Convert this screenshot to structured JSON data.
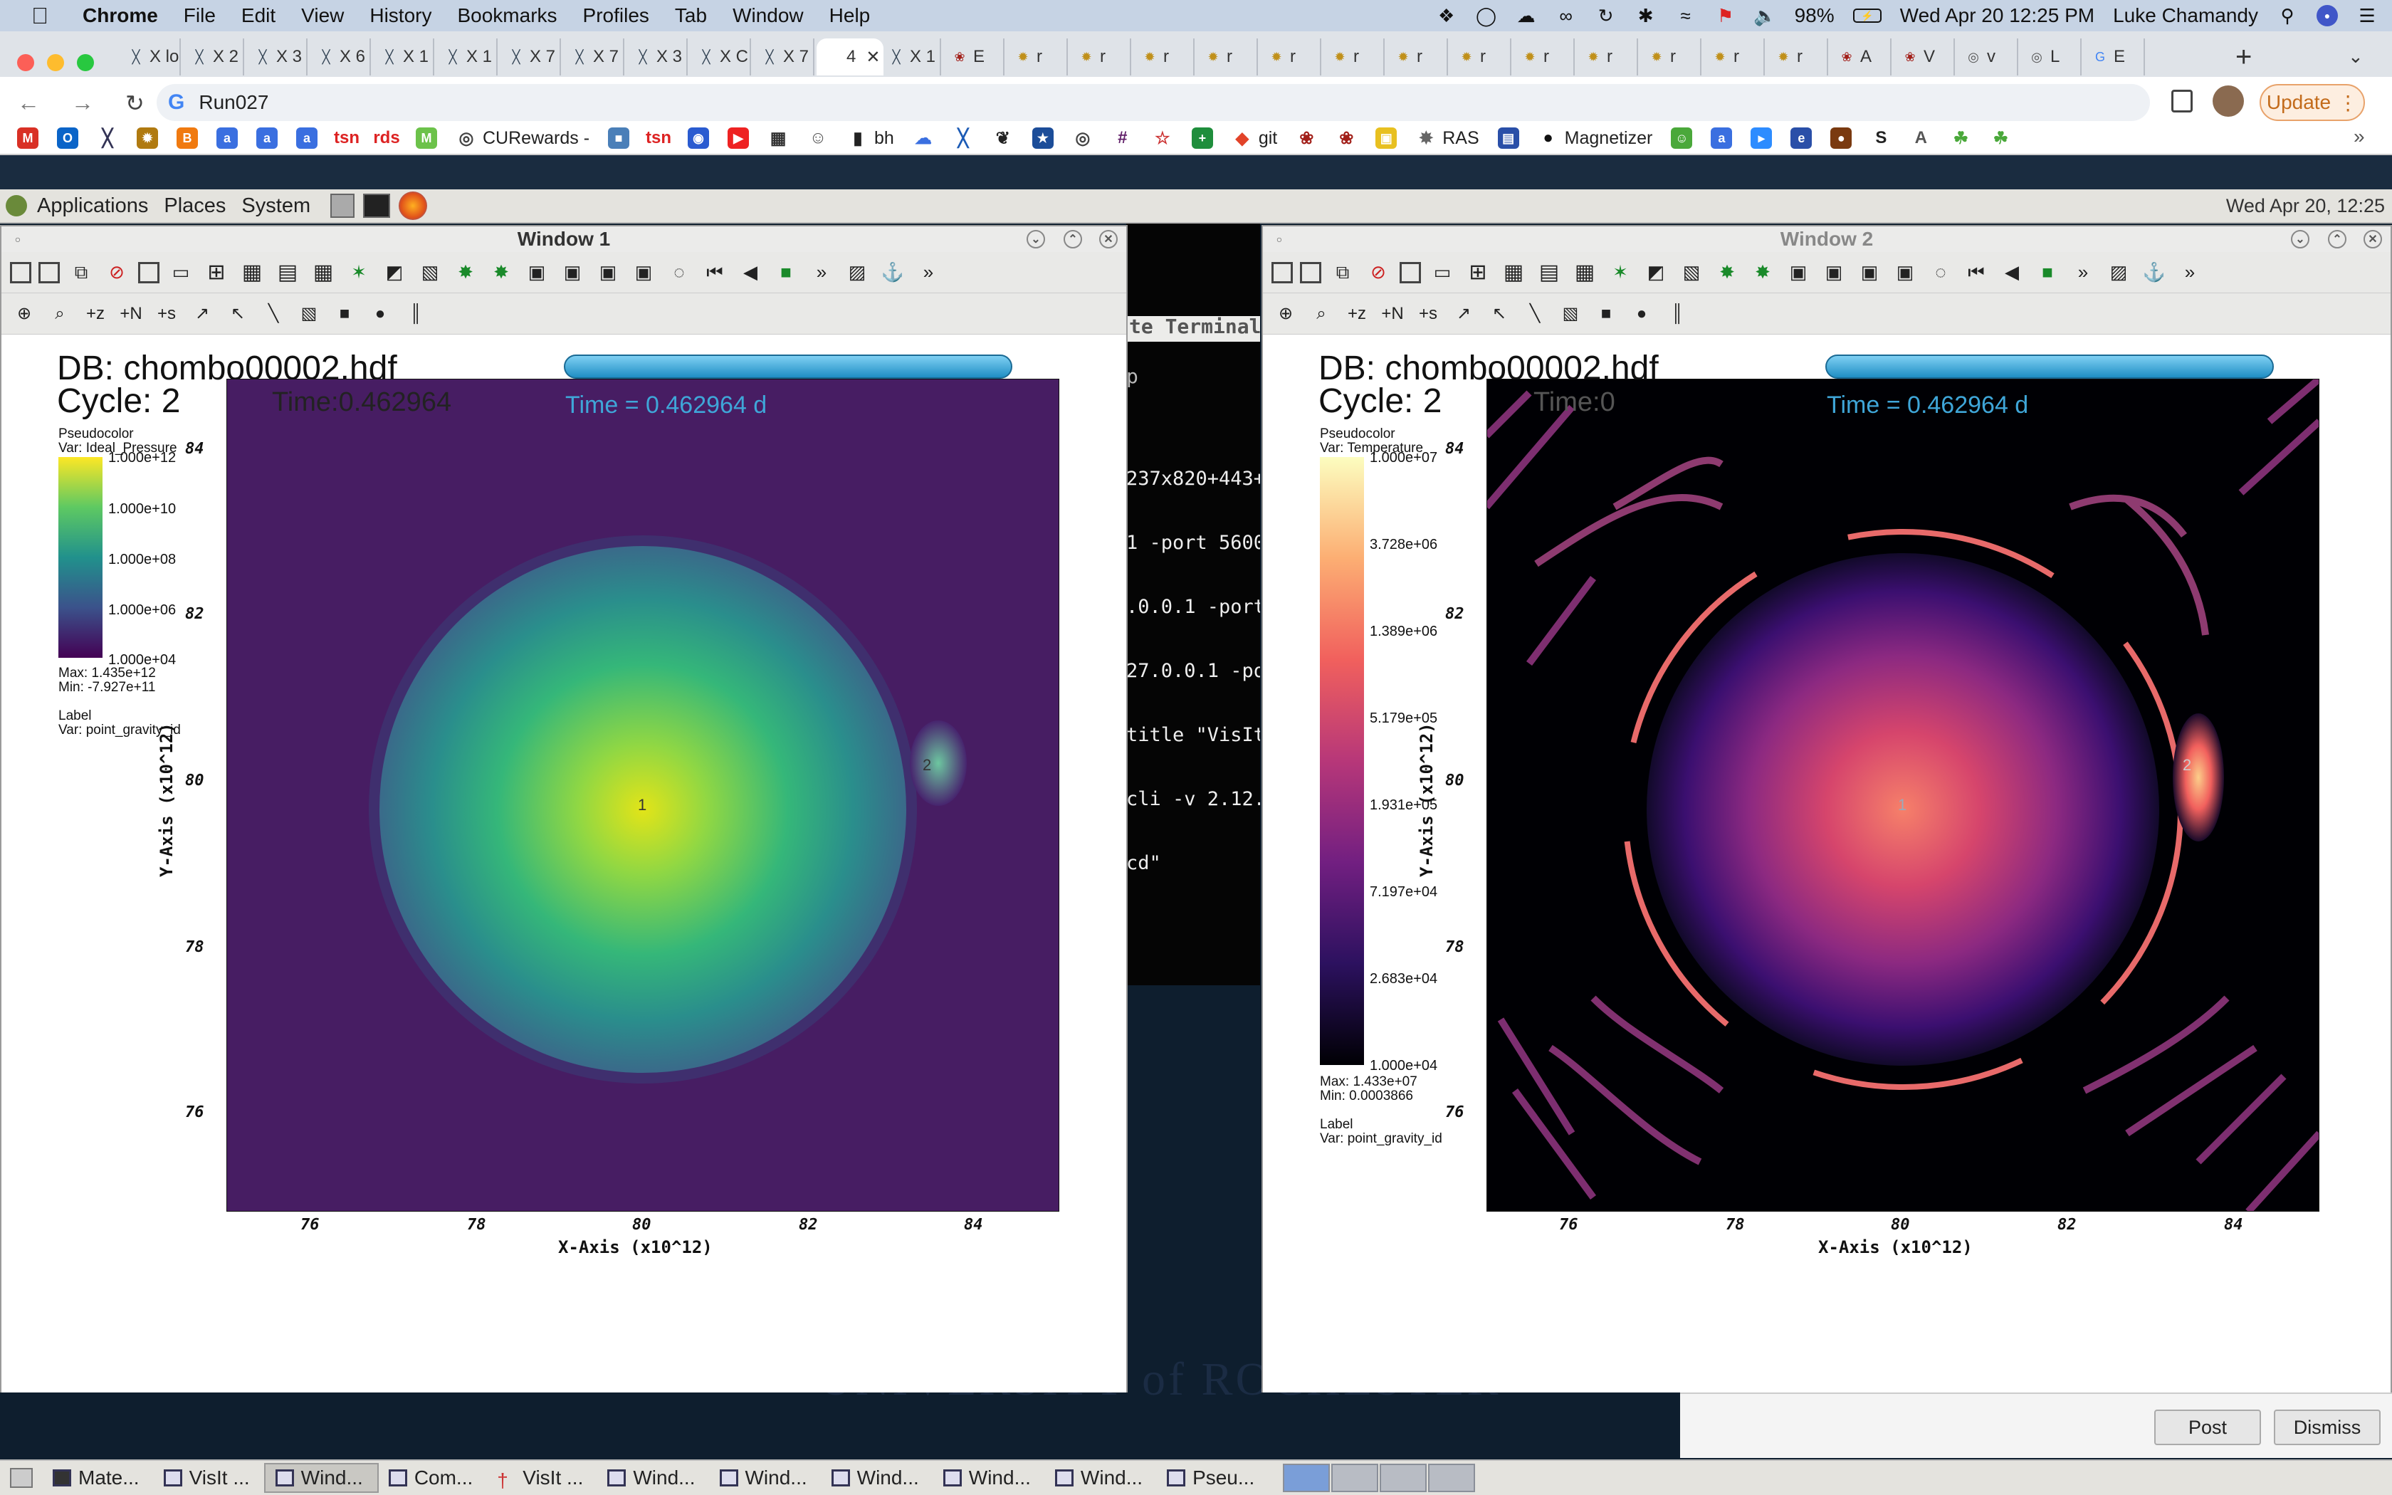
{
  "menubar": {
    "app": "Chrome",
    "items": [
      "File",
      "Edit",
      "View",
      "History",
      "Bookmarks",
      "Profiles",
      "Tab",
      "Window",
      "Help"
    ],
    "battery": "98%",
    "clock": "Wed Apr 20  12:25 PM",
    "user": "Luke Chamandy"
  },
  "browser": {
    "tabs": [
      {
        "label": "X lo",
        "icon": "x-tab-icon"
      },
      {
        "label": "X 2",
        "icon": "x-tab-icon"
      },
      {
        "label": "X 3",
        "icon": "x-tab-icon"
      },
      {
        "label": "X 6",
        "icon": "x-tab-icon"
      },
      {
        "label": "X 1",
        "icon": "x-tab-icon"
      },
      {
        "label": "X 1",
        "icon": "x-tab-icon"
      },
      {
        "label": "X 7",
        "icon": "x-tab-icon"
      },
      {
        "label": "X 7",
        "icon": "x-tab-icon"
      },
      {
        "label": "X 3",
        "icon": "x-tab-icon"
      },
      {
        "label": "X C",
        "icon": "x-tab-icon"
      },
      {
        "label": "X 7",
        "icon": "x-tab-icon"
      },
      {
        "label": "4",
        "icon": "active-tab",
        "active": true
      },
      {
        "label": "X 1",
        "icon": "x-tab-icon"
      },
      {
        "label": "E",
        "icon": "paw-icon"
      },
      {
        "label": "r",
        "icon": "star-burst-icon"
      },
      {
        "label": "r",
        "icon": "star-burst-icon"
      },
      {
        "label": "r",
        "icon": "star-burst-icon"
      },
      {
        "label": "r",
        "icon": "star-burst-icon"
      },
      {
        "label": "r",
        "icon": "star-burst-icon"
      },
      {
        "label": "r",
        "icon": "star-burst-icon"
      },
      {
        "label": "r",
        "icon": "star-burst-icon"
      },
      {
        "label": "r",
        "icon": "star-burst-icon"
      },
      {
        "label": "r",
        "icon": "star-burst-icon"
      },
      {
        "label": "r",
        "icon": "star-burst-icon"
      },
      {
        "label": "r",
        "icon": "star-burst-icon"
      },
      {
        "label": "r",
        "icon": "star-burst-icon"
      },
      {
        "label": "r",
        "icon": "star-burst-icon"
      },
      {
        "label": "A",
        "icon": "paw-icon"
      },
      {
        "label": "V",
        "icon": "paw-icon"
      },
      {
        "label": "v",
        "icon": "globe-icon"
      },
      {
        "label": "L",
        "icon": "globe-icon"
      },
      {
        "label": "E",
        "icon": "google-icon"
      }
    ],
    "address": "Run027",
    "update_label": "Update",
    "bookmarks": [
      {
        "label": "",
        "icon": "gmail-icon",
        "color": "#d93025"
      },
      {
        "label": "",
        "icon": "outlook-icon",
        "color": "#0a64c8"
      },
      {
        "label": "",
        "icon": "x-bookmark-icon",
        "color": "#335"
      },
      {
        "label": "",
        "icon": "sun-icon",
        "color": "#b07a10"
      },
      {
        "label": "",
        "icon": "blogger-icon",
        "color": "#f07a10"
      },
      {
        "label": "",
        "icon": "a-icon",
        "color": "#3a6fe0"
      },
      {
        "label": "",
        "icon": "a-icon",
        "color": "#3a6fe0"
      },
      {
        "label": "",
        "icon": "a-icon",
        "color": "#3a6fe0"
      },
      {
        "label": "",
        "icon": "tsn-icon",
        "color": "#d22"
      },
      {
        "label": "",
        "icon": "rds-icon",
        "color": "#d22"
      },
      {
        "label": "",
        "icon": "m-icon",
        "color": "#6cc24a"
      },
      {
        "label": "CURewards -",
        "icon": "globe-icon",
        "color": "#444"
      },
      {
        "label": "",
        "icon": "square-icon",
        "color": "#4a7fb8"
      },
      {
        "label": "",
        "icon": "tsn-icon",
        "color": "#d22"
      },
      {
        "label": "",
        "icon": "circle-icon",
        "color": "#2a5bd0"
      },
      {
        "label": "",
        "icon": "youtube-icon",
        "color": "#e22"
      },
      {
        "label": "",
        "icon": "qr-icon",
        "color": "#333"
      },
      {
        "label": "",
        "icon": "face-icon",
        "color": "#555"
      },
      {
        "label": "bh",
        "icon": "book-icon",
        "color": "#222"
      },
      {
        "label": "",
        "icon": "cloud-icon",
        "color": "#3a6fe0"
      },
      {
        "label": "",
        "icon": "x-bookmark-icon",
        "color": "#1c5bb5"
      },
      {
        "label": "",
        "icon": "cat-icon",
        "color": "#222"
      },
      {
        "label": "",
        "icon": "star-icon",
        "color": "#1c4d99"
      },
      {
        "label": "",
        "icon": "globe-icon",
        "color": "#444"
      },
      {
        "label": "",
        "icon": "slack-icon",
        "color": "#611f69"
      },
      {
        "label": "",
        "icon": "star-outline-icon",
        "color": "#c33"
      },
      {
        "label": "",
        "icon": "plus-icon",
        "color": "#1f8e3c"
      },
      {
        "label": "git",
        "icon": "gitlab-icon",
        "color": "#e24329"
      },
      {
        "label": "",
        "icon": "paw-icon",
        "color": "#a2201a"
      },
      {
        "label": "",
        "icon": "paw-icon",
        "color": "#a2201a"
      },
      {
        "label": "",
        "icon": "lock-icon",
        "color": "#e8c020"
      },
      {
        "label": "RAS",
        "icon": "spinner-icon",
        "color": "#666"
      },
      {
        "label": "",
        "icon": "calendar-icon",
        "color": "#2a4fa8"
      },
      {
        "label": "Magnetizer",
        "icon": "github-icon",
        "color": "#111"
      },
      {
        "label": "",
        "icon": "smile-icon",
        "color": "#4aa83a"
      },
      {
        "label": "",
        "icon": "a-icon",
        "color": "#3a6fe0"
      },
      {
        "label": "",
        "icon": "zoom-icon",
        "color": "#2d8cff"
      },
      {
        "label": "",
        "icon": "e-icon",
        "color": "#2a4fa8"
      },
      {
        "label": "",
        "icon": "planet-icon",
        "color": "#7a3a10"
      },
      {
        "label": "",
        "icon": "s-icon",
        "color": "#222"
      },
      {
        "label": "",
        "icon": "ai-icon",
        "color": "#555"
      },
      {
        "label": "",
        "icon": "leaf-icon",
        "color": "#4aa83a"
      },
      {
        "label": "",
        "icon": "leaf-icon",
        "color": "#4aa83a"
      }
    ]
  },
  "gnome": {
    "items": [
      "Applications",
      "Places",
      "System"
    ],
    "clock": "Wed Apr 20, 12:25"
  },
  "window1": {
    "title": "Window 1",
    "db": "DB: chombo00002.hdf",
    "cycle": "Cycle: 2",
    "time_overlay": "Time:0.462964",
    "time_blue": "Time = 0.462964 d",
    "legend": {
      "kind": "Pseudocolor",
      "var": "Var: Ideal_Pressure",
      "ticks": [
        "1.000e+12",
        "1.000e+10",
        "1.000e+08",
        "1.000e+06",
        "1.000e+04"
      ],
      "max": "Max:  1.435e+12",
      "min": "Min:  -7.927e+11",
      "label_kind": "Label",
      "label_var": "Var: point_gravity_id"
    },
    "marker": "1",
    "marker2": "2"
  },
  "window2": {
    "title": "Window 2",
    "db": "DB: chombo00002.hdf",
    "cycle": "Cycle: 2",
    "time_overlay": "Time:0",
    "time_blue": "Time = 0.462964 d",
    "legend": {
      "kind": "Pseudocolor",
      "var": "Var: Temperature",
      "ticks": [
        "1.000e+07",
        "3.728e+06",
        "1.389e+06",
        "5.179e+05",
        "1.931e+05",
        "7.197e+04",
        "2.683e+04",
        "1.000e+04"
      ],
      "max": "Max:  1.433e+07",
      "min": "Min:  0.0003866",
      "label_kind": "Label",
      "label_var": "Var: point_gravity_id"
    },
    "marker": "1",
    "marker2": "2"
  },
  "axes": {
    "x_ticks": [
      "76",
      "78",
      "80",
      "82",
      "84"
    ],
    "y_ticks": [
      "84",
      "82",
      "80",
      "78",
      "76"
    ],
    "xlabel": "X-Axis (x10^12)",
    "ylabel": "Y-Axis (x10^12)"
  },
  "terminal": {
    "title": "te Terminal",
    "title2": "p",
    "lines": [
      "237x820+443+",
      "1 -port 5600",
      ".0.0.1 -port",
      "27.0.0.1 -po",
      "title \"VisIt",
      "cli -v 2.12.",
      "cd\""
    ]
  },
  "background_text": "UNIVERSITY of ROCHESTER",
  "notification": {
    "post": "Post",
    "dismiss": "Dismiss"
  },
  "taskbar": [
    {
      "label": "Mate...",
      "icon": "terminal-icon"
    },
    {
      "label": "VisIt ...",
      "icon": "window-icon"
    },
    {
      "label": "Wind...",
      "icon": "window-icon",
      "active": true
    },
    {
      "label": "Com...",
      "icon": "window-icon"
    },
    {
      "label": "VisIt ...",
      "icon": "visit-icon"
    },
    {
      "label": "Wind...",
      "icon": "window-icon"
    },
    {
      "label": "Wind...",
      "icon": "window-icon"
    },
    {
      "label": "Wind...",
      "icon": "window-icon"
    },
    {
      "label": "Wind...",
      "icon": "window-icon"
    },
    {
      "label": "Wind...",
      "icon": "window-icon"
    },
    {
      "label": "Pseu...",
      "icon": "window-icon"
    }
  ],
  "colors": {
    "viridis_low": "#440154",
    "viridis_high": "#fde725",
    "magma_low": "#000004",
    "magma_high": "#fcfdbf",
    "accent_blue": "#3fa6d8"
  }
}
